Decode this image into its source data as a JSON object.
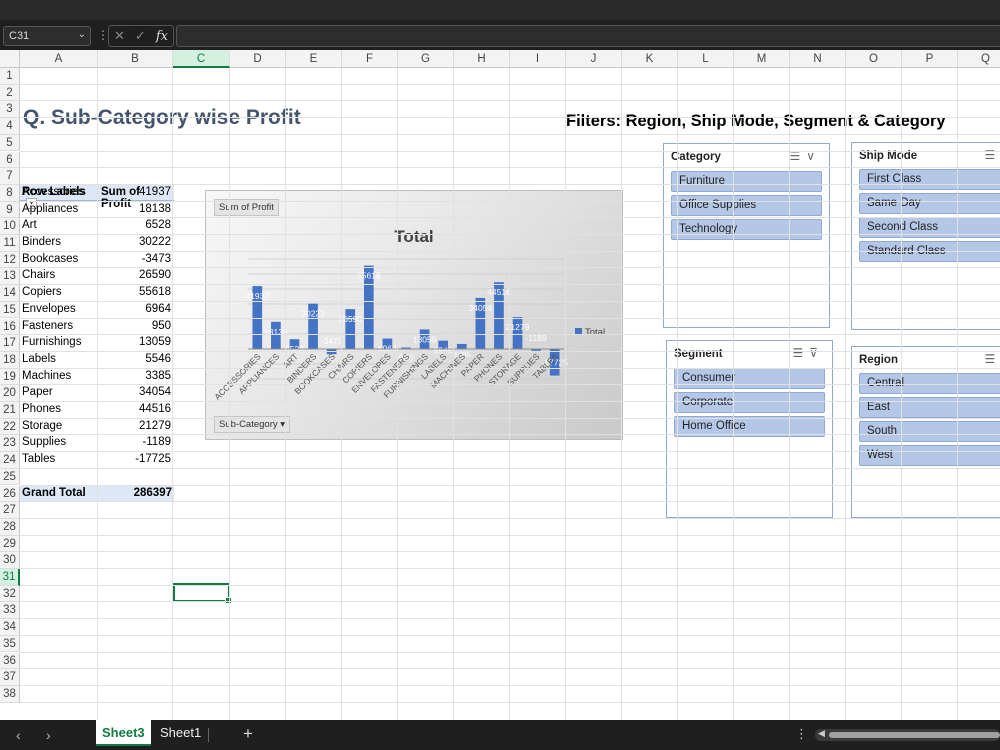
{
  "formula_bar": {
    "name_box": "C31",
    "fx": "fx",
    "cancel": "✕",
    "enter": "✓"
  },
  "columns": [
    "A",
    "B",
    "C",
    "D",
    "E",
    "F",
    "G",
    "H",
    "I",
    "J",
    "K",
    "L",
    "M",
    "N",
    "O",
    "P",
    "Q"
  ],
  "rows": [
    "1",
    "2",
    "3",
    "4",
    "5",
    "6",
    "7",
    "8",
    "9",
    "10",
    "11",
    "12",
    "13",
    "14",
    "15",
    "16",
    "17",
    "18",
    "19",
    "20",
    "21",
    "22",
    "23",
    "24",
    "25",
    "26",
    "27",
    "28",
    "29",
    "30",
    "31",
    "32",
    "33",
    "34",
    "35",
    "36",
    "37",
    "38"
  ],
  "sheet_title": "Q. Sub-Category wise Profit",
  "filters_label": "Filters: Region, Ship Mode, Segment & Category",
  "pivot": {
    "header_row_labels": "Row Labels",
    "header_sum": "Sum of Profit",
    "rows": [
      {
        "label": "Accessories",
        "value": "41937"
      },
      {
        "label": "Appliances",
        "value": "18138"
      },
      {
        "label": "Art",
        "value": "6528"
      },
      {
        "label": "Binders",
        "value": "30222"
      },
      {
        "label": "Bookcases",
        "value": "-3473"
      },
      {
        "label": "Chairs",
        "value": "26590"
      },
      {
        "label": "Copiers",
        "value": "55618"
      },
      {
        "label": "Envelopes",
        "value": "6964"
      },
      {
        "label": "Fasteners",
        "value": "950"
      },
      {
        "label": "Furnishings",
        "value": "13059"
      },
      {
        "label": "Labels",
        "value": "5546"
      },
      {
        "label": "Machines",
        "value": "3385"
      },
      {
        "label": "Paper",
        "value": "34054"
      },
      {
        "label": "Phones",
        "value": "44516"
      },
      {
        "label": "Storage",
        "value": "21279"
      },
      {
        "label": "Supplies",
        "value": "-1189"
      },
      {
        "label": "Tables",
        "value": "-17725"
      }
    ],
    "total_label": "Grand Total",
    "total_value": "286397"
  },
  "chart_data": {
    "type": "bar",
    "title": "Total",
    "field_button": "Sum of Profit",
    "axis_button": "Sub-Category",
    "legend": "Total",
    "categories": [
      "ACCESSORIES",
      "APPLIANCES",
      "ART",
      "BINDERS",
      "BOOKCASES",
      "CHAIRS",
      "COPIERS",
      "ENVELOPES",
      "FASTENERS",
      "FURNISHINGS",
      "LABELS",
      "MACHINES",
      "PAPER",
      "PHONES",
      "STORAGE",
      "SUPPLIES",
      "TABLES"
    ],
    "values": [
      41937,
      18138,
      6528,
      30222,
      -3473,
      26590,
      55618,
      6964,
      950,
      13059,
      5546,
      3385,
      34054,
      44516,
      21279,
      -1189,
      -17725
    ],
    "data_labels": [
      "41937",
      "18138",
      "6528",
      "30222",
      "-3473",
      "26590",
      "55618",
      "6964",
      "950",
      "13059",
      "5546",
      "3385",
      "34054",
      "44516",
      "21279",
      "-1189",
      "-17725"
    ],
    "ylim": [
      -20000,
      60000
    ],
    "grid": true,
    "legend_position": "right",
    "colors": {
      "bar": "#4472c4"
    }
  },
  "slicers": {
    "category": {
      "title": "Category",
      "items": [
        "Furniture",
        "Office Supplies",
        "Technology"
      ]
    },
    "ship_mode": {
      "title": "Ship Mode",
      "items": [
        "First Class",
        "Same Day",
        "Second Class",
        "Standard Class"
      ]
    },
    "segment": {
      "title": "Segment",
      "items": [
        "Consumer",
        "Corporate",
        "Home Office"
      ]
    },
    "region": {
      "title": "Region",
      "items": [
        "Central",
        "East",
        "South",
        "West"
      ]
    }
  },
  "sheet_tabs": {
    "active": "Sheet3",
    "other": "Sheet1",
    "add": "+"
  },
  "colors": {
    "accent": "#107c41",
    "title": "#44546a",
    "slicer_item": "#b4c7e7",
    "pivot_header": "#dde7f5"
  }
}
